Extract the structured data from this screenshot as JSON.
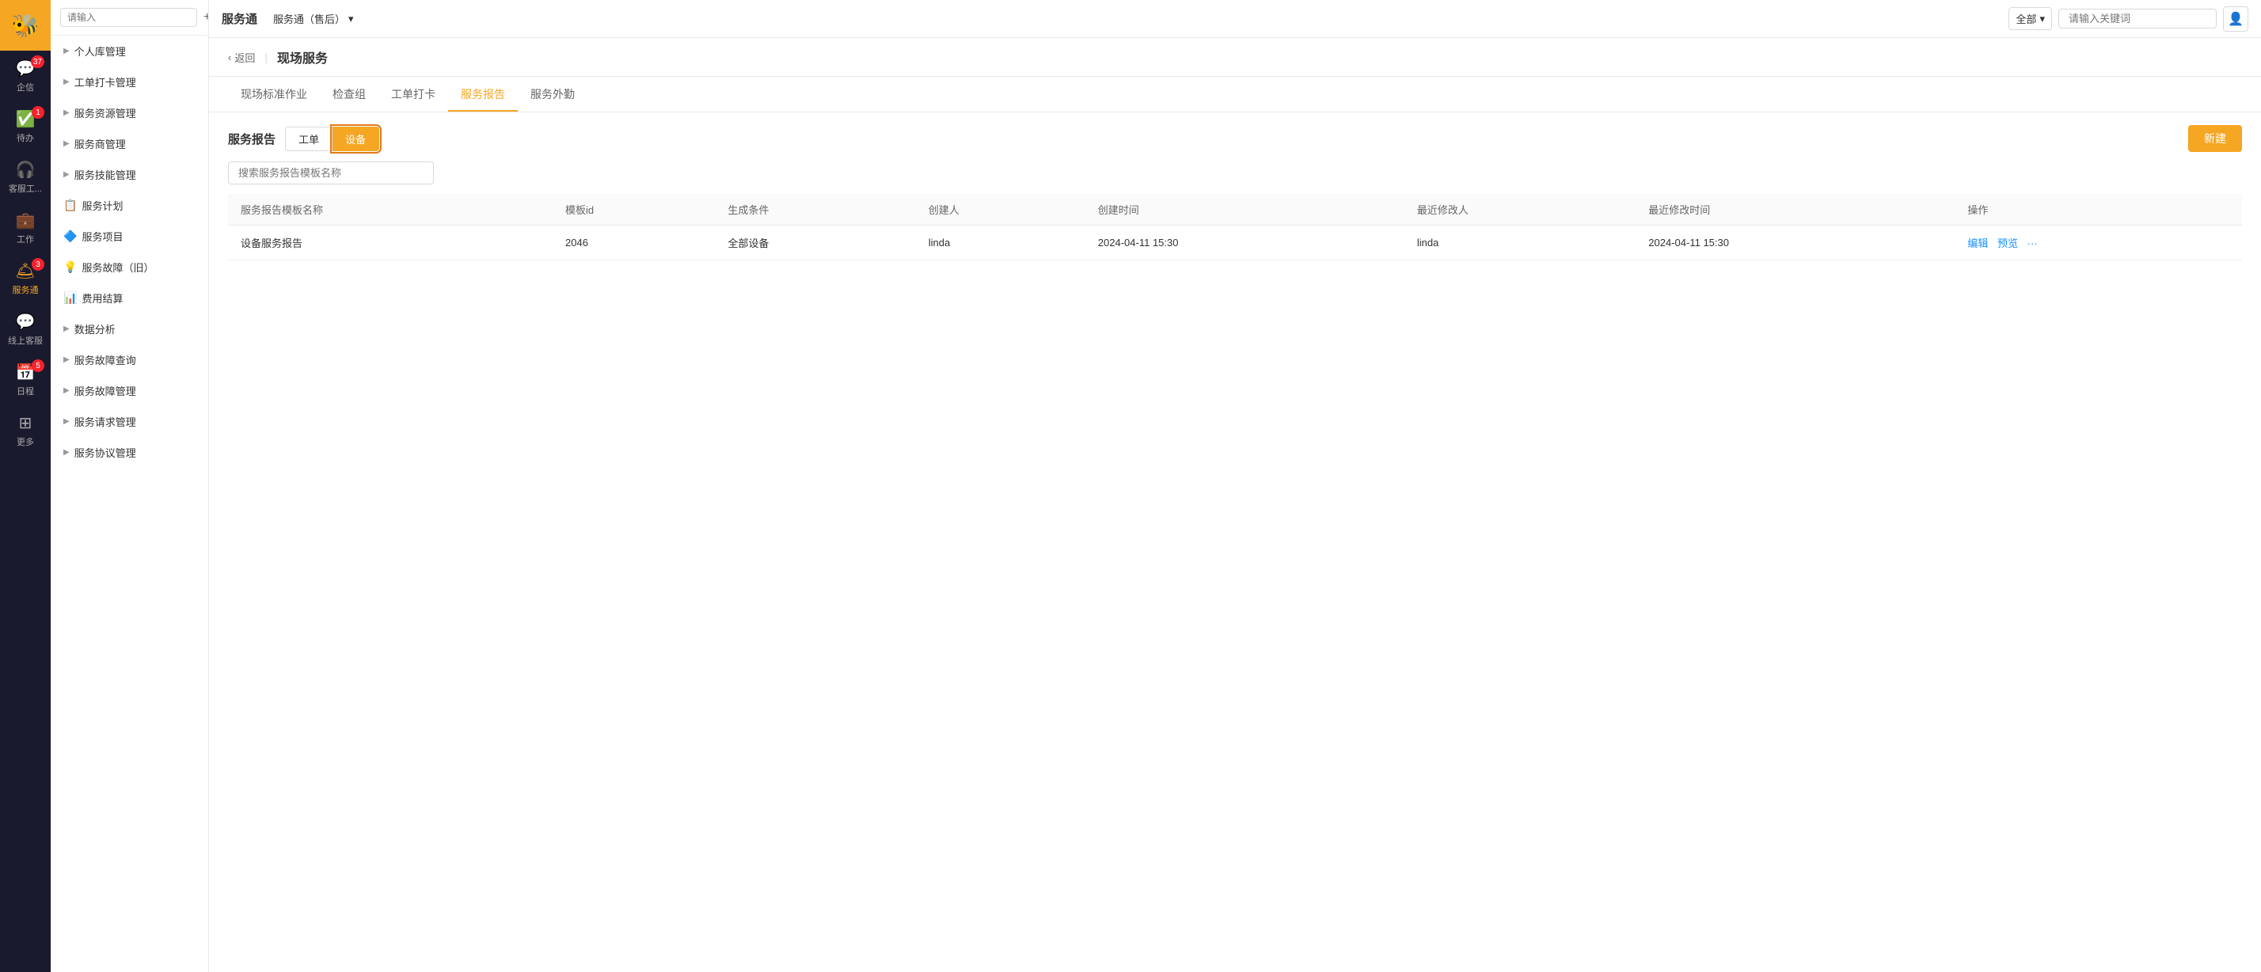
{
  "app": {
    "logo": "🐝",
    "title": "服务通",
    "subtitle": "服务通（售后）",
    "search_placeholder": "请输入关键词",
    "scope_label": "全部"
  },
  "sidebar_dark": {
    "items": [
      {
        "id": "qixin",
        "icon": "💬",
        "label": "企信",
        "badge": "37"
      },
      {
        "id": "daiban",
        "icon": "✔",
        "label": "待办",
        "badge": "1"
      },
      {
        "id": "kefu",
        "icon": "🎧",
        "label": "客服工..."
      },
      {
        "id": "gongzuo",
        "icon": "💼",
        "label": "工作"
      },
      {
        "id": "fuwutong",
        "icon": "🛎",
        "label": "服务通",
        "active": true,
        "badge": "3"
      },
      {
        "id": "zaixiankefu",
        "icon": "💬",
        "label": "线上客服"
      },
      {
        "id": "richeng",
        "icon": "📅",
        "label": "日程",
        "badge_text": "5"
      },
      {
        "id": "gengduo",
        "icon": "⊞",
        "label": "更多"
      }
    ]
  },
  "sidebar_white": {
    "search_placeholder": "请输入",
    "menu_items": [
      {
        "id": "gerenkuguanli",
        "label": "个人库管理",
        "has_arrow": true
      },
      {
        "id": "gongdandakaiguanli",
        "label": "工单打卡管理",
        "has_arrow": true
      },
      {
        "id": "fuwuziyuanguanli",
        "label": "服务资源管理",
        "has_arrow": true
      },
      {
        "id": "fuwushangjiangu",
        "label": "服务商管理",
        "has_arrow": true
      },
      {
        "id": "fuwujineng",
        "label": "服务技能管理",
        "has_arrow": true
      },
      {
        "id": "fuwujihua",
        "label": "服务计划",
        "icon": "📋"
      },
      {
        "id": "fuwuxiangmu",
        "label": "服务项目",
        "icon": "🔷"
      },
      {
        "id": "fuwuzhangai",
        "label": "服务故障（旧）",
        "icon": "💡"
      },
      {
        "id": "feiyongjiesuan",
        "label": "费用结算",
        "icon": "📊"
      },
      {
        "id": "shujufenxi",
        "label": "数据分析",
        "has_arrow": true
      },
      {
        "id": "fuwuzhangaichaxun",
        "label": "服务故障查询",
        "has_arrow": true
      },
      {
        "id": "fuwuzhangaiguanli",
        "label": "服务故障管理",
        "has_arrow": true
      },
      {
        "id": "fuwuqiuguanli",
        "label": "服务请求管理",
        "has_arrow": true
      },
      {
        "id": "fuwuxieyiguanli",
        "label": "服务协议管理",
        "has_arrow": true
      }
    ]
  },
  "page_header": {
    "back_label": "返回",
    "title": "现场服务"
  },
  "tabs": [
    {
      "id": "biaozhunzuoye",
      "label": "现场标准作业"
    },
    {
      "id": "jianchachu",
      "label": "检查组"
    },
    {
      "id": "gongdandaka",
      "label": "工单打卡"
    },
    {
      "id": "fuwubaogao",
      "label": "服务报告",
      "active": true
    },
    {
      "id": "fuwuwaiqin",
      "label": "服务外勤"
    }
  ],
  "sub_section": {
    "title": "服务报告",
    "sub_tabs": [
      {
        "id": "gongdan",
        "label": "工单"
      },
      {
        "id": "shebei",
        "label": "设备",
        "active": true
      }
    ],
    "new_button_label": "新建"
  },
  "search": {
    "placeholder": "搜索服务报告模板名称"
  },
  "table": {
    "columns": [
      {
        "id": "name",
        "label": "服务报告模板名称"
      },
      {
        "id": "template_id",
        "label": "模板id"
      },
      {
        "id": "condition",
        "label": "生成条件"
      },
      {
        "id": "creator",
        "label": "创建人"
      },
      {
        "id": "create_time",
        "label": "创建时间"
      },
      {
        "id": "last_modifier",
        "label": "最近修改人"
      },
      {
        "id": "last_modify_time",
        "label": "最近修改时间"
      },
      {
        "id": "actions",
        "label": "操作"
      }
    ],
    "rows": [
      {
        "name": "设备服务报告",
        "template_id": "2046",
        "condition": "全部设备",
        "creator": "linda",
        "create_time": "2024-04-11 15:30",
        "last_modifier": "linda",
        "last_modify_time": "2024-04-11 15:30",
        "actions": [
          {
            "label": "编辑",
            "type": "edit"
          },
          {
            "label": "预览",
            "type": "preview"
          },
          {
            "label": "···",
            "type": "more"
          }
        ]
      }
    ]
  }
}
